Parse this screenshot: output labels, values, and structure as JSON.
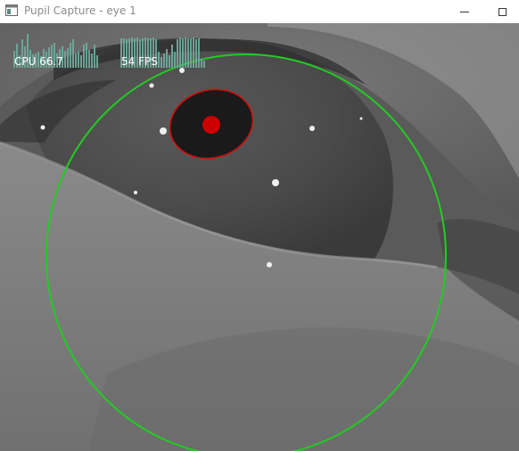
{
  "window": {
    "title": "Pupil Capture - eye 1"
  },
  "overlay": {
    "cpu_text": "CPU 66.7",
    "fps_text": "54 FPS",
    "graph_color": "#6fa89a",
    "pupil_ellipse_color": "#d01010",
    "pupil_center_color": "#cc0000",
    "eyeball_circle_color": "#22cc22"
  },
  "icons": [
    "app-window-icon",
    "minimize-icon",
    "maximize-icon"
  ]
}
